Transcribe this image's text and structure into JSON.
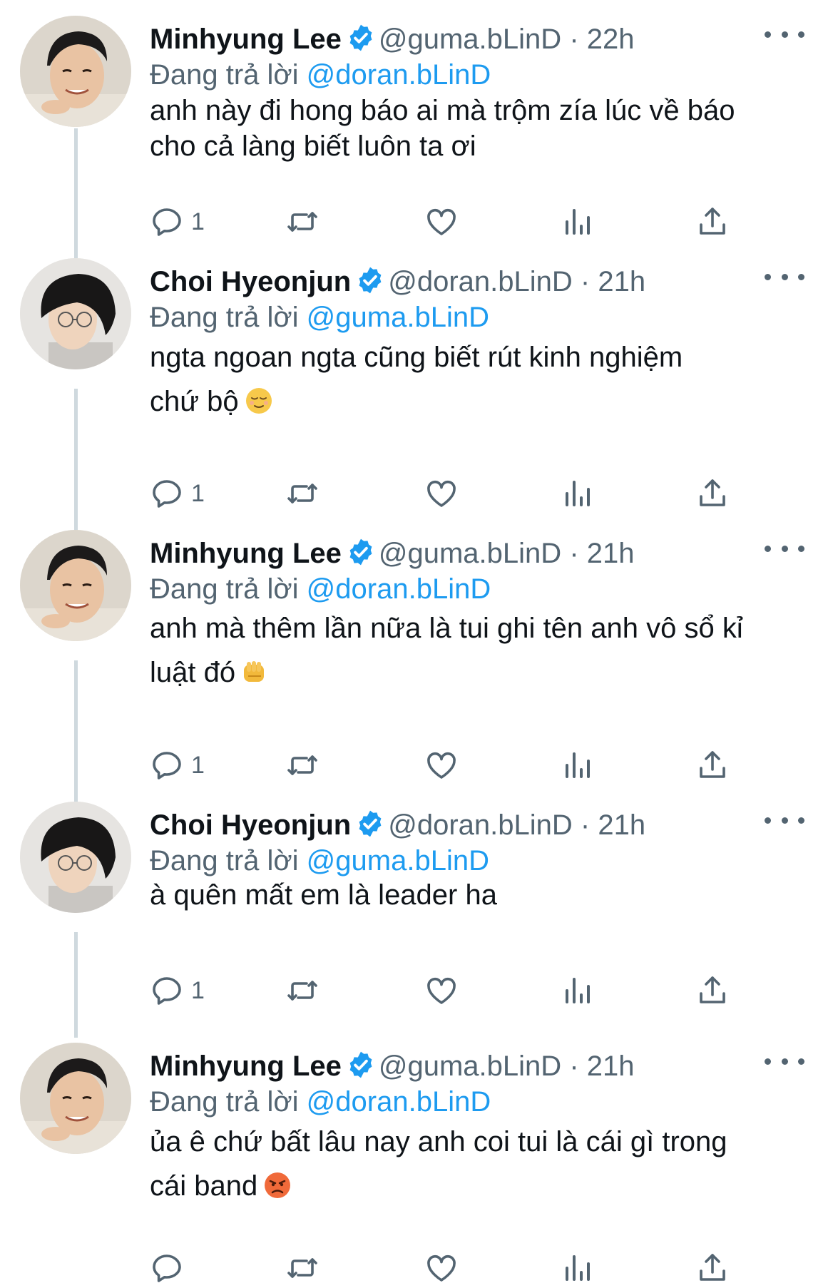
{
  "colors": {
    "accent": "#1d9bf0",
    "secondary_text": "#536471",
    "thread_line": "#cfd9de"
  },
  "tweets": [
    {
      "name": "Minhyung Lee",
      "handle": "@guma.bLinD",
      "sep": "·",
      "time": "22h",
      "reply_prefix": "Đang trả lời",
      "reply_to": "@doran.bLinD",
      "text": "anh này đi hong báo ai mà trộm zía lúc về báo\ncho cả làng biết luôn ta ơi",
      "emoji": "",
      "reply_count": "1"
    },
    {
      "name": "Choi Hyeonjun",
      "handle": "@doran.bLinD",
      "sep": "·",
      "time": "21h",
      "reply_prefix": "Đang trả lời",
      "reply_to": "@guma.bLinD",
      "text": "ngta ngoan ngta cũng biết rút kinh nghiệm\nchứ bộ",
      "emoji": "relieved-face",
      "reply_count": "1"
    },
    {
      "name": "Minhyung Lee",
      "handle": "@guma.bLinD",
      "sep": "·",
      "time": "21h",
      "reply_prefix": "Đang trả lời",
      "reply_to": "@doran.bLinD",
      "text": "anh mà thêm lần nữa là tui ghi tên anh vô sổ kỉ\nluật đó",
      "emoji": "fist",
      "reply_count": "1"
    },
    {
      "name": "Choi Hyeonjun",
      "handle": "@doran.bLinD",
      "sep": "·",
      "time": "21h",
      "reply_prefix": "Đang trả lời",
      "reply_to": "@guma.bLinD",
      "text": "à quên mất em là leader ha",
      "emoji": "",
      "reply_count": "1"
    },
    {
      "name": "Minhyung Lee",
      "handle": "@guma.bLinD",
      "sep": "·",
      "time": "21h",
      "reply_prefix": "Đang trả lời",
      "reply_to": "@doran.bLinD",
      "text": "ủa ê chứ bất lâu nay anh coi tui là cái gì trong\ncái band",
      "emoji": "angry-face",
      "reply_count": ""
    }
  ]
}
